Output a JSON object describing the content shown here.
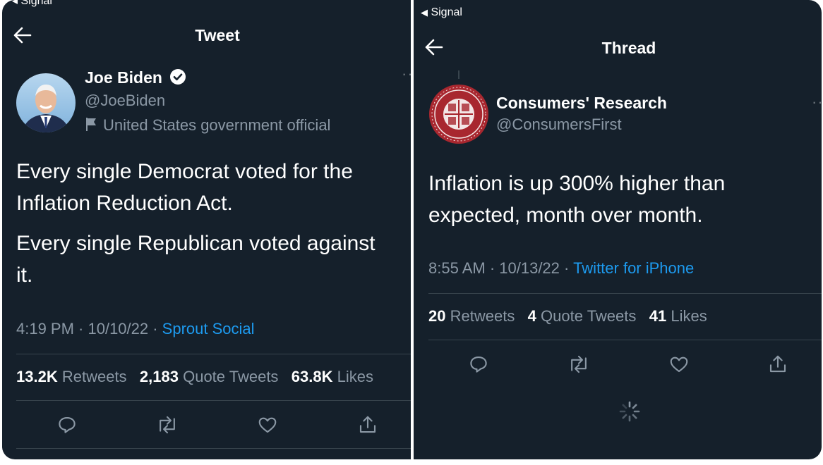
{
  "left": {
    "status_app": "Signal",
    "header_title": "Tweet",
    "author": {
      "name": "Joe Biden",
      "handle": "@JoeBiden",
      "label": "United States government official"
    },
    "body": [
      "Every single Democrat voted for the",
      "Inflation Reduction Act.",
      "Every single Republican voted against",
      "it."
    ],
    "timestamp": "4:19 PM · 10/10/22 · ",
    "source": "Sprout Social",
    "stats": {
      "retweets_count": "13.2K",
      "retweets_label": "Retweets",
      "quotes_count": "2,183",
      "quotes_label": "Quote Tweets",
      "likes_count": "63.8K",
      "likes_label": "Likes"
    }
  },
  "right": {
    "status_app": "Signal",
    "header_title": "Thread",
    "author": {
      "name": "Consumers' Research",
      "handle": "@ConsumersFirst"
    },
    "body": [
      "Inflation is up 300% higher than",
      "expected, month over month."
    ],
    "timestamp": "8:55 AM · 10/13/22 · ",
    "source": "Twitter for iPhone",
    "stats": {
      "retweets_count": "20",
      "retweets_label": "Retweets",
      "quotes_count": "4",
      "quotes_label": "Quote Tweets",
      "likes_count": "41",
      "likes_label": "Likes"
    }
  },
  "colors": {
    "background": "#15202b",
    "link": "#1d9bf0",
    "secondary_text": "#8b98a5",
    "divider": "#38444d",
    "logo_red": "#a8272f"
  }
}
